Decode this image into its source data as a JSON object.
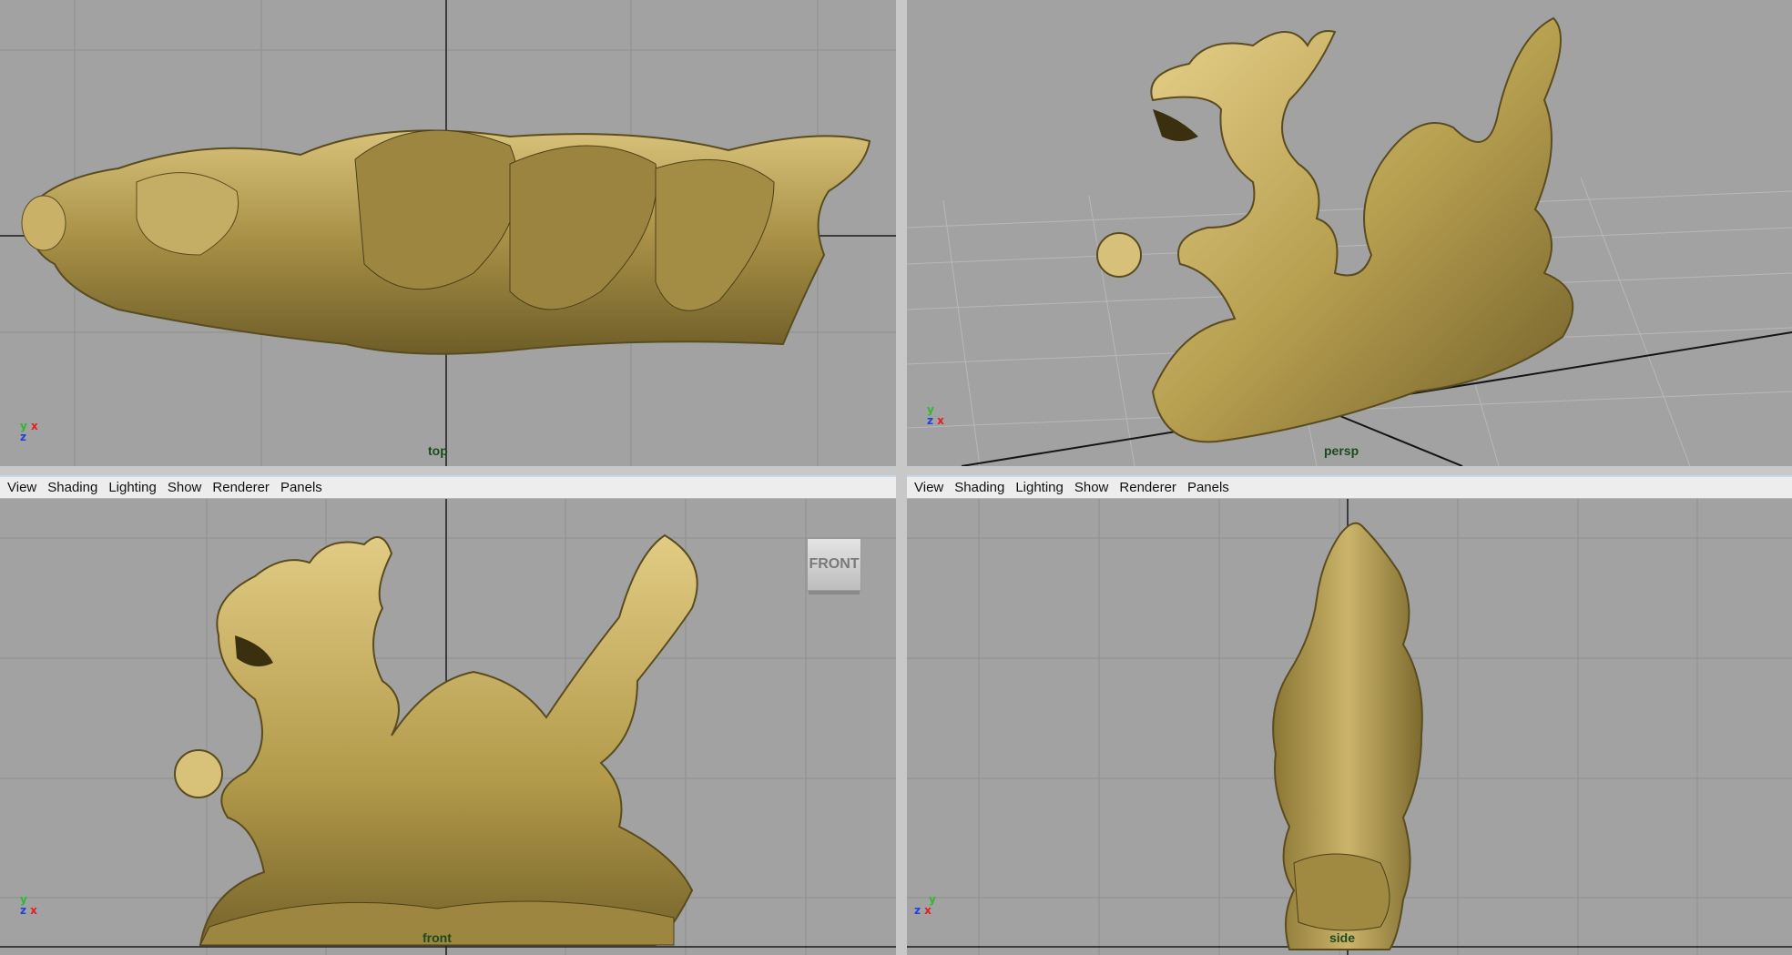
{
  "menu": {
    "items": [
      "View",
      "Shading",
      "Lighting",
      "Show",
      "Renderer",
      "Panels"
    ]
  },
  "viewports": {
    "top": {
      "label": "top"
    },
    "persp": {
      "label": "persp"
    },
    "front": {
      "label": "front",
      "cube_label": "FRONT"
    },
    "side": {
      "label": "side"
    }
  },
  "axes": {
    "x": "x",
    "y": "y",
    "z": "z"
  },
  "colors": {
    "viewport_bg": "#a2a2a2",
    "grid": "#8c8c8c",
    "model_gold": "#b8a254",
    "menu_bg": "#ededed"
  }
}
